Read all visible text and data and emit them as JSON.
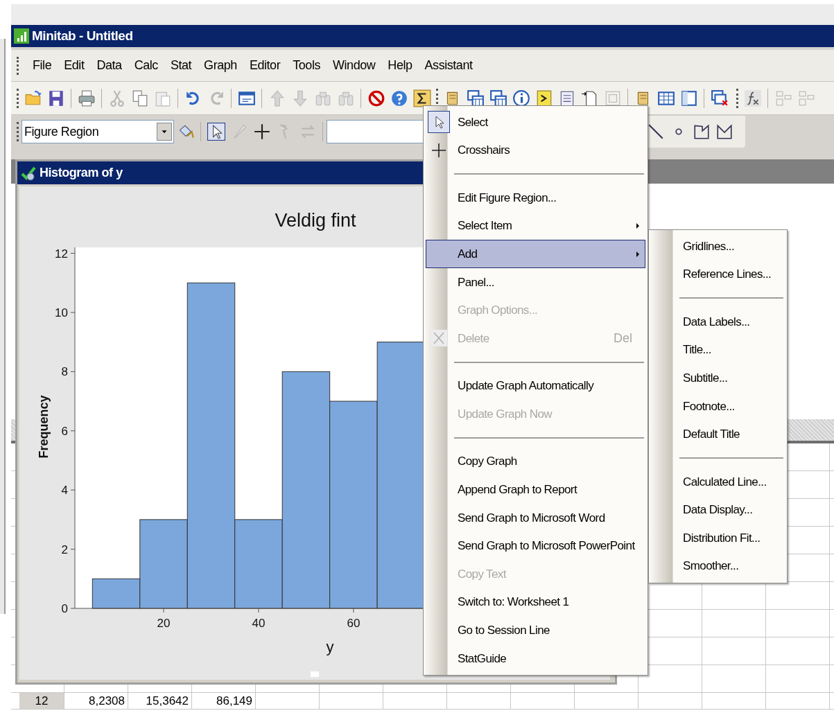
{
  "window": {
    "title": "Minitab - Untitled"
  },
  "menu_bar": [
    {
      "label": "File"
    },
    {
      "label": "Edit"
    },
    {
      "label": "Data"
    },
    {
      "label": "Calc"
    },
    {
      "label": "Stat"
    },
    {
      "label": "Graph"
    },
    {
      "label": "Editor"
    },
    {
      "label": "Tools"
    },
    {
      "label": "Window"
    },
    {
      "label": "Help"
    },
    {
      "label": "Assistant"
    }
  ],
  "toolbar": {
    "region_dropdown": {
      "value": "Figure Region"
    }
  },
  "graph_window": {
    "title": "Histogram of y",
    "chart_data": {
      "type": "bar",
      "title": "Veldig fint",
      "xlabel": "y",
      "ylabel": "Frequency",
      "x": [
        10,
        20,
        30,
        40,
        50,
        60,
        70
      ],
      "values": [
        1,
        3,
        11,
        3,
        8,
        7,
        9
      ],
      "xlim": [
        1.3,
        112.3
      ],
      "ylim": [
        0,
        12.2
      ],
      "xticks": [
        20,
        40,
        60
      ],
      "yticks": [
        0,
        2,
        4,
        6,
        8,
        10,
        12
      ]
    }
  },
  "context_menu": [
    {
      "kind": "tool",
      "label": "Select",
      "checked": true
    },
    {
      "kind": "tool",
      "label": "Crosshairs",
      "checked": false
    },
    {
      "kind": "separator"
    },
    {
      "kind": "command",
      "label": "Edit Figure Region...",
      "disabled": false,
      "submenu": false,
      "selected": false
    },
    {
      "kind": "command",
      "label": "Select Item",
      "disabled": false,
      "submenu": true,
      "selected": false
    },
    {
      "kind": "command",
      "label": "Add",
      "disabled": false,
      "submenu": true,
      "selected": true
    },
    {
      "kind": "command",
      "label": "Panel...",
      "disabled": false,
      "submenu": false,
      "selected": false
    },
    {
      "kind": "command",
      "label": "Graph Options...",
      "disabled": true,
      "submenu": false,
      "selected": false
    },
    {
      "kind": "command",
      "label": "Delete",
      "shortcut": "Del",
      "disabled": true,
      "submenu": false,
      "selected": false
    },
    {
      "kind": "separator"
    },
    {
      "kind": "command",
      "label": "Update Graph Automatically",
      "disabled": false,
      "submenu": false,
      "selected": false
    },
    {
      "kind": "command",
      "label": "Update Graph Now",
      "disabled": true,
      "submenu": false,
      "selected": false
    },
    {
      "kind": "separator"
    },
    {
      "kind": "command",
      "label": "Copy Graph",
      "disabled": false,
      "submenu": false,
      "selected": false
    },
    {
      "kind": "command",
      "label": "Append Graph to Report",
      "disabled": false,
      "submenu": false,
      "selected": false
    },
    {
      "kind": "command",
      "label": "Send Graph to Microsoft Word",
      "disabled": false,
      "submenu": false,
      "selected": false
    },
    {
      "kind": "command",
      "label": "Send Graph to Microsoft PowerPoint",
      "disabled": false,
      "submenu": false,
      "selected": false
    },
    {
      "kind": "command",
      "label": "Copy Text",
      "disabled": true,
      "submenu": false,
      "selected": false
    },
    {
      "kind": "command",
      "label": "Switch to: Worksheet 1",
      "disabled": false,
      "submenu": false,
      "selected": false
    },
    {
      "kind": "command",
      "label": "Go to Session Line",
      "disabled": false,
      "submenu": false,
      "selected": false
    },
    {
      "kind": "command",
      "label": "StatGuide",
      "disabled": false,
      "submenu": false,
      "selected": false
    }
  ],
  "add_submenu": [
    {
      "kind": "command",
      "label": "Gridlines..."
    },
    {
      "kind": "command",
      "label": "Reference Lines..."
    },
    {
      "kind": "separator"
    },
    {
      "kind": "command",
      "label": "Data Labels..."
    },
    {
      "kind": "command",
      "label": "Title..."
    },
    {
      "kind": "command",
      "label": "Subtitle..."
    },
    {
      "kind": "command",
      "label": "Footnote..."
    },
    {
      "kind": "command",
      "label": "Default Title"
    },
    {
      "kind": "separator"
    },
    {
      "kind": "command",
      "label": "Calculated Line..."
    },
    {
      "kind": "command",
      "label": "Data Display..."
    },
    {
      "kind": "command",
      "label": "Distribution Fit..."
    },
    {
      "kind": "command",
      "label": "Smoother..."
    }
  ],
  "worksheet": {
    "rows": [
      {
        "row": "12",
        "cells": [
          "8,2308",
          "15,3642",
          "86,149"
        ]
      }
    ]
  }
}
